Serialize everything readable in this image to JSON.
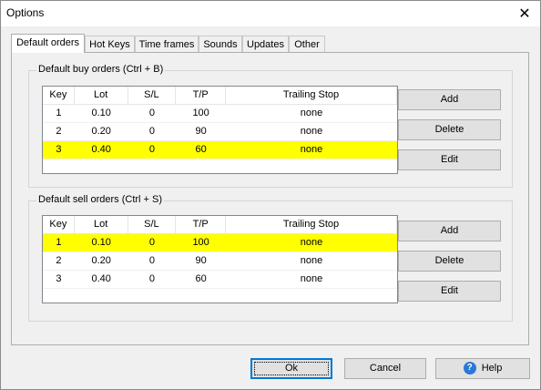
{
  "window": {
    "title": "Options",
    "close_glyph": "✕"
  },
  "tabs": [
    "Default orders",
    "Hot Keys",
    "Time frames",
    "Sounds",
    "Updates",
    "Other"
  ],
  "columns": [
    "Key",
    "Lot",
    "S/L",
    "T/P",
    "Trailing Stop"
  ],
  "buy": {
    "title": "Default buy orders (Ctrl + B)",
    "rows": [
      [
        "1",
        "0.10",
        "0",
        "100",
        "none"
      ],
      [
        "2",
        "0.20",
        "0",
        "90",
        "none"
      ],
      [
        "3",
        "0.40",
        "0",
        "60",
        "none"
      ]
    ],
    "selected_row": 2
  },
  "sell": {
    "title": "Default sell orders (Ctrl + S)",
    "rows": [
      [
        "1",
        "0.10",
        "0",
        "100",
        "none"
      ],
      [
        "2",
        "0.20",
        "0",
        "90",
        "none"
      ],
      [
        "3",
        "0.40",
        "0",
        "60",
        "none"
      ]
    ],
    "selected_row": 0
  },
  "side_buttons": {
    "add": "Add",
    "delete": "Delete",
    "edit": "Edit"
  },
  "footer": {
    "ok": "Ok",
    "cancel": "Cancel",
    "help": "Help",
    "help_icon_glyph": "?"
  },
  "colors": {
    "highlight": "#ffff00",
    "default_button_border": "#0078d7",
    "help_icon": "#2a78d6"
  }
}
